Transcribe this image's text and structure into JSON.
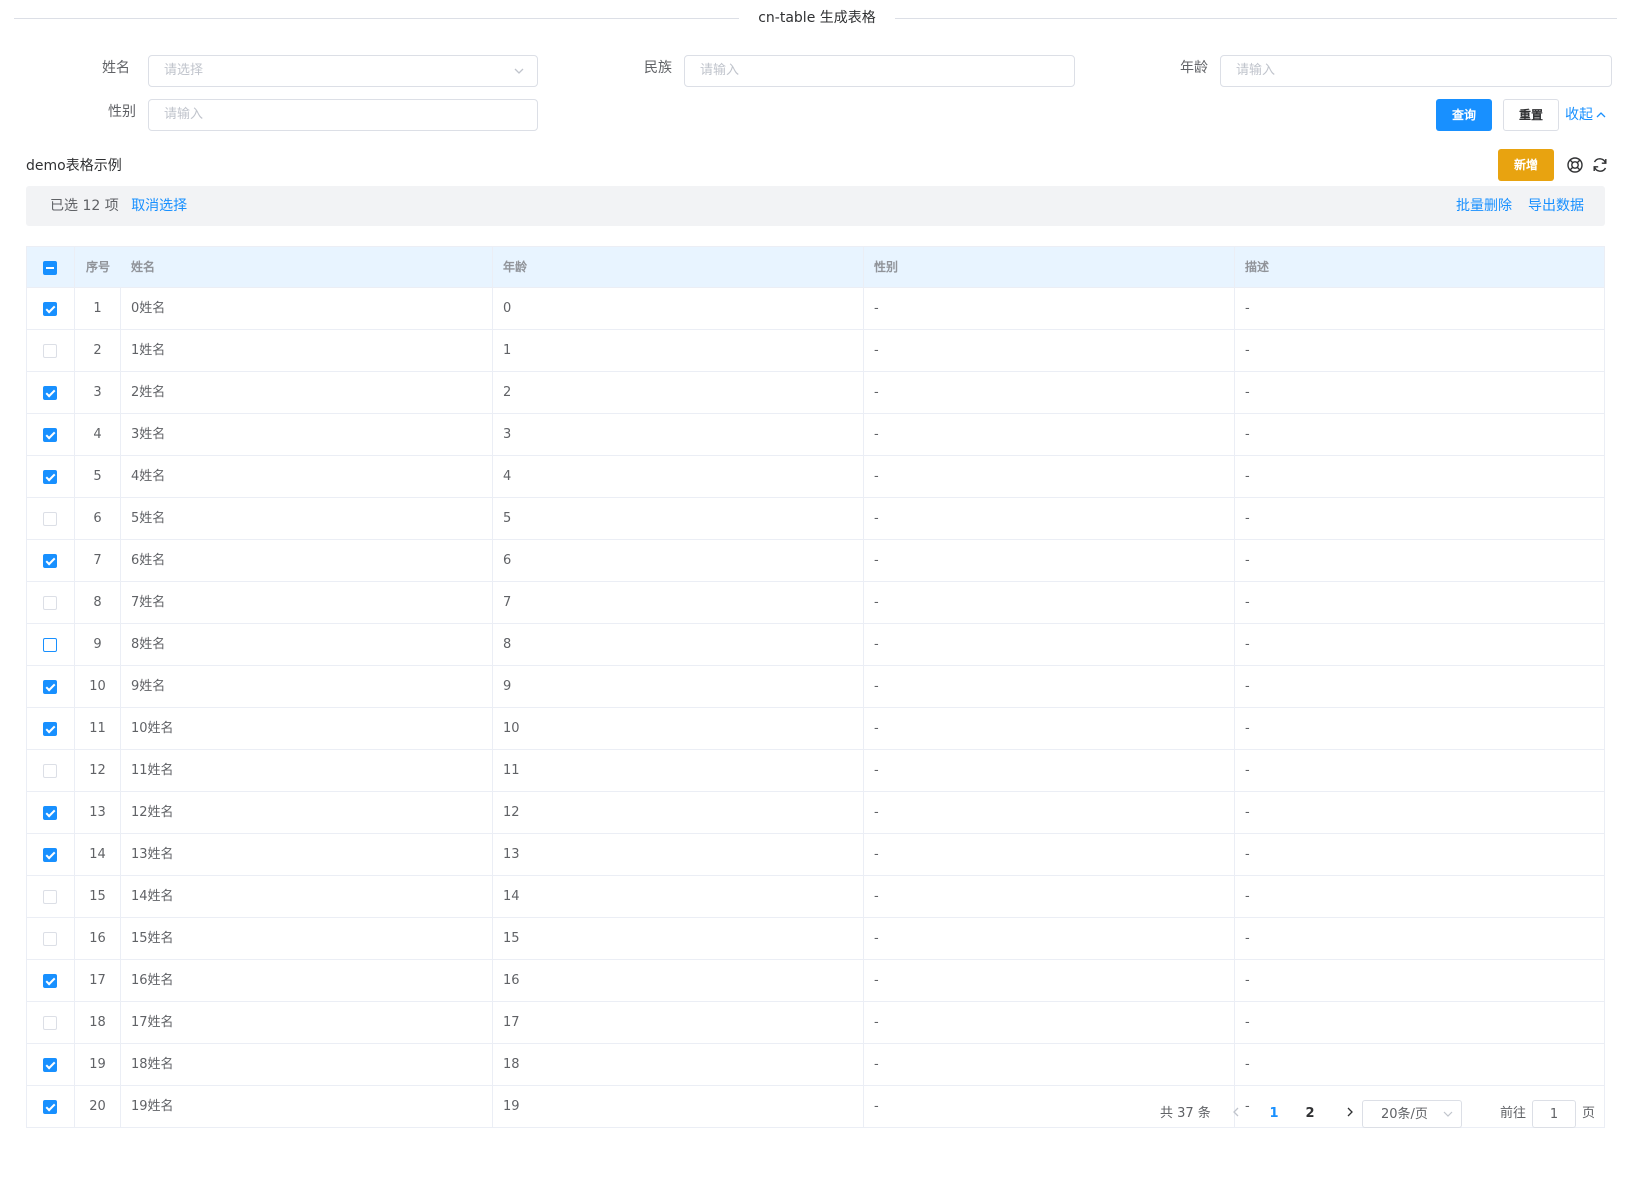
{
  "page_title": "cn-table 生成表格",
  "search": {
    "fields": [
      {
        "label": "姓名",
        "placeholder": "请选择",
        "type": "select"
      },
      {
        "label": "民族",
        "placeholder": "请输入",
        "type": "input"
      },
      {
        "label": "年龄",
        "placeholder": "请输入",
        "type": "input"
      },
      {
        "label": "性别",
        "placeholder": "请输入",
        "type": "input"
      }
    ],
    "query_label": "查询",
    "reset_label": "重置",
    "collapse_label": "收起"
  },
  "toolbar": {
    "title": "demo表格示例",
    "add_label": "新增",
    "settings_icon": "settings-icon",
    "refresh_icon": "refresh-icon"
  },
  "selection": {
    "prefix": "已选",
    "count": "12",
    "suffix": "项",
    "clear_label": "取消选择",
    "batch_delete_label": "批量删除",
    "export_label": "导出数据"
  },
  "table": {
    "columns": [
      "序号",
      "姓名",
      "年龄",
      "性别",
      "描述"
    ],
    "header_checkbox": "indeterminate",
    "rows": [
      {
        "idx": "1",
        "name": "0姓名",
        "age": "0",
        "sex": "-",
        "desc": "-",
        "checked": true
      },
      {
        "idx": "2",
        "name": "1姓名",
        "age": "1",
        "sex": "-",
        "desc": "-",
        "checked": false
      },
      {
        "idx": "3",
        "name": "2姓名",
        "age": "2",
        "sex": "-",
        "desc": "-",
        "checked": true
      },
      {
        "idx": "4",
        "name": "3姓名",
        "age": "3",
        "sex": "-",
        "desc": "-",
        "checked": true
      },
      {
        "idx": "5",
        "name": "4姓名",
        "age": "4",
        "sex": "-",
        "desc": "-",
        "checked": true
      },
      {
        "idx": "6",
        "name": "5姓名",
        "age": "5",
        "sex": "-",
        "desc": "-",
        "checked": false
      },
      {
        "idx": "7",
        "name": "6姓名",
        "age": "6",
        "sex": "-",
        "desc": "-",
        "checked": true
      },
      {
        "idx": "8",
        "name": "7姓名",
        "age": "7",
        "sex": "-",
        "desc": "-",
        "checked": false
      },
      {
        "idx": "9",
        "name": "8姓名",
        "age": "8",
        "sex": "-",
        "desc": "-",
        "checked": false,
        "focused": true
      },
      {
        "idx": "10",
        "name": "9姓名",
        "age": "9",
        "sex": "-",
        "desc": "-",
        "checked": true
      },
      {
        "idx": "11",
        "name": "10姓名",
        "age": "10",
        "sex": "-",
        "desc": "-",
        "checked": true
      },
      {
        "idx": "12",
        "name": "11姓名",
        "age": "11",
        "sex": "-",
        "desc": "-",
        "checked": false
      },
      {
        "idx": "13",
        "name": "12姓名",
        "age": "12",
        "sex": "-",
        "desc": "-",
        "checked": true
      },
      {
        "idx": "14",
        "name": "13姓名",
        "age": "13",
        "sex": "-",
        "desc": "-",
        "checked": true
      },
      {
        "idx": "15",
        "name": "14姓名",
        "age": "14",
        "sex": "-",
        "desc": "-",
        "checked": false
      },
      {
        "idx": "16",
        "name": "15姓名",
        "age": "15",
        "sex": "-",
        "desc": "-",
        "checked": false
      },
      {
        "idx": "17",
        "name": "16姓名",
        "age": "16",
        "sex": "-",
        "desc": "-",
        "checked": true
      },
      {
        "idx": "18",
        "name": "17姓名",
        "age": "17",
        "sex": "-",
        "desc": "-",
        "checked": false
      },
      {
        "idx": "19",
        "name": "18姓名",
        "age": "18",
        "sex": "-",
        "desc": "-",
        "checked": true
      },
      {
        "idx": "20",
        "name": "19姓名",
        "age": "19",
        "sex": "-",
        "desc": "-",
        "checked": true
      }
    ]
  },
  "pagination": {
    "total_text": "共 37 条",
    "pages": [
      "1",
      "2"
    ],
    "current_page": "1",
    "page_size": "20条/页",
    "goto_label": "前往",
    "goto_value": "1",
    "unit_label": "页"
  },
  "colors": {
    "primary": "#1890ff",
    "warning": "#e8a310",
    "header_bg": "#e8f4ff",
    "selection_bar_bg": "#f2f3f5"
  }
}
